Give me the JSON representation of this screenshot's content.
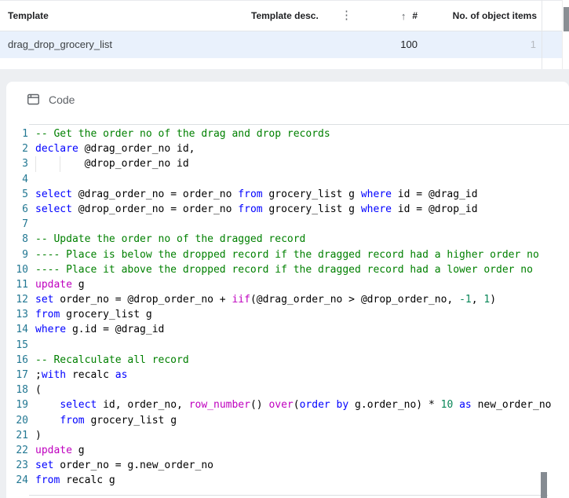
{
  "table": {
    "header": {
      "template": "Template",
      "template_desc": "Template desc.",
      "column_menu": "⋮",
      "sort_arrow": "↑",
      "number": "#",
      "object_items": "No. of object items"
    },
    "row": {
      "template": "drag_drop_grocery_list",
      "number_value": "100",
      "object_items_value": "1"
    }
  },
  "panel": {
    "title": "Code"
  },
  "editor": {
    "lines": [
      {
        "n": "1",
        "tokens": [
          {
            "t": "-- Get the order no of the drag and drop records",
            "c": "com"
          }
        ]
      },
      {
        "n": "2",
        "tokens": [
          {
            "t": "declare",
            "c": "kw"
          },
          {
            "t": " @drag_order_no id,",
            "c": "txt"
          }
        ]
      },
      {
        "n": "3",
        "guides": true,
        "tokens": [
          {
            "t": "        @drop_order_no id",
            "c": "txt"
          }
        ]
      },
      {
        "n": "4",
        "tokens": []
      },
      {
        "n": "5",
        "tokens": [
          {
            "t": "select",
            "c": "kw"
          },
          {
            "t": " @drag_order_no = order_no ",
            "c": "txt"
          },
          {
            "t": "from",
            "c": "kw"
          },
          {
            "t": " grocery_list g ",
            "c": "txt"
          },
          {
            "t": "where",
            "c": "kw"
          },
          {
            "t": " id = @drag_id",
            "c": "txt"
          }
        ]
      },
      {
        "n": "6",
        "tokens": [
          {
            "t": "select",
            "c": "kw"
          },
          {
            "t": " @drop_order_no = order_no ",
            "c": "txt"
          },
          {
            "t": "from",
            "c": "kw"
          },
          {
            "t": " grocery_list g ",
            "c": "txt"
          },
          {
            "t": "where",
            "c": "kw"
          },
          {
            "t": " id = @drop_id",
            "c": "txt"
          }
        ]
      },
      {
        "n": "7",
        "tokens": []
      },
      {
        "n": "8",
        "tokens": [
          {
            "t": "-- Update the order no of the dragged record",
            "c": "com"
          }
        ]
      },
      {
        "n": "9",
        "tokens": [
          {
            "t": "---- Place is below the dropped record if the dragged record had a higher order no",
            "c": "com"
          }
        ]
      },
      {
        "n": "10",
        "tokens": [
          {
            "t": "---- Place it above the dropped record if the dragged record had a lower order no",
            "c": "com"
          }
        ]
      },
      {
        "n": "11",
        "tokens": [
          {
            "t": "update",
            "c": "fn"
          },
          {
            "t": " g",
            "c": "txt"
          }
        ]
      },
      {
        "n": "12",
        "tokens": [
          {
            "t": "set",
            "c": "kw"
          },
          {
            "t": " order_no = @drop_order_no + ",
            "c": "txt"
          },
          {
            "t": "iif",
            "c": "fn"
          },
          {
            "t": "(@drag_order_no > @drop_order_no, ",
            "c": "txt"
          },
          {
            "t": "-1",
            "c": "num"
          },
          {
            "t": ", ",
            "c": "txt"
          },
          {
            "t": "1",
            "c": "num"
          },
          {
            "t": ")",
            "c": "txt"
          }
        ]
      },
      {
        "n": "13",
        "tokens": [
          {
            "t": "from",
            "c": "kw"
          },
          {
            "t": " grocery_list g",
            "c": "txt"
          }
        ]
      },
      {
        "n": "14",
        "tokens": [
          {
            "t": "where",
            "c": "kw"
          },
          {
            "t": " g.id = @drag_id",
            "c": "txt"
          }
        ]
      },
      {
        "n": "15",
        "tokens": []
      },
      {
        "n": "16",
        "tokens": [
          {
            "t": "-- Recalculate all record",
            "c": "com"
          }
        ]
      },
      {
        "n": "17",
        "tokens": [
          {
            "t": ";",
            "c": "txt"
          },
          {
            "t": "with",
            "c": "kw"
          },
          {
            "t": " recalc ",
            "c": "txt"
          },
          {
            "t": "as",
            "c": "kw"
          }
        ]
      },
      {
        "n": "18",
        "tokens": [
          {
            "t": "(",
            "c": "txt"
          }
        ]
      },
      {
        "n": "19",
        "tokens": [
          {
            "t": "    ",
            "c": "txt"
          },
          {
            "t": "select",
            "c": "kw"
          },
          {
            "t": " id, order_no, ",
            "c": "txt"
          },
          {
            "t": "row_number",
            "c": "fn"
          },
          {
            "t": "() ",
            "c": "txt"
          },
          {
            "t": "over",
            "c": "fn"
          },
          {
            "t": "(",
            "c": "txt"
          },
          {
            "t": "order by",
            "c": "kw"
          },
          {
            "t": " g.order_no) * ",
            "c": "txt"
          },
          {
            "t": "10",
            "c": "num"
          },
          {
            "t": " ",
            "c": "txt"
          },
          {
            "t": "as",
            "c": "kw"
          },
          {
            "t": " new_order_no",
            "c": "txt"
          }
        ]
      },
      {
        "n": "20",
        "tokens": [
          {
            "t": "    ",
            "c": "txt"
          },
          {
            "t": "from",
            "c": "kw"
          },
          {
            "t": " grocery_list g",
            "c": "txt"
          }
        ]
      },
      {
        "n": "21",
        "tokens": [
          {
            "t": ")",
            "c": "txt"
          }
        ]
      },
      {
        "n": "22",
        "tokens": [
          {
            "t": "update",
            "c": "fn"
          },
          {
            "t": " g",
            "c": "txt"
          }
        ]
      },
      {
        "n": "23",
        "tokens": [
          {
            "t": "set",
            "c": "kw"
          },
          {
            "t": " order_no = g.new_order_no",
            "c": "txt"
          }
        ]
      },
      {
        "n": "24",
        "tokens": [
          {
            "t": "from",
            "c": "kw"
          },
          {
            "t": " recalc g",
            "c": "txt"
          }
        ]
      }
    ]
  },
  "colors": {
    "keyword": "#0000ff",
    "function_keyword": "#bf00bf",
    "comment": "#008000",
    "number": "#098658",
    "line_number": "#237893",
    "selected_row_bg": "#e9f1fc",
    "header_text": "#1f2023",
    "muted_text": "#5f6368"
  }
}
